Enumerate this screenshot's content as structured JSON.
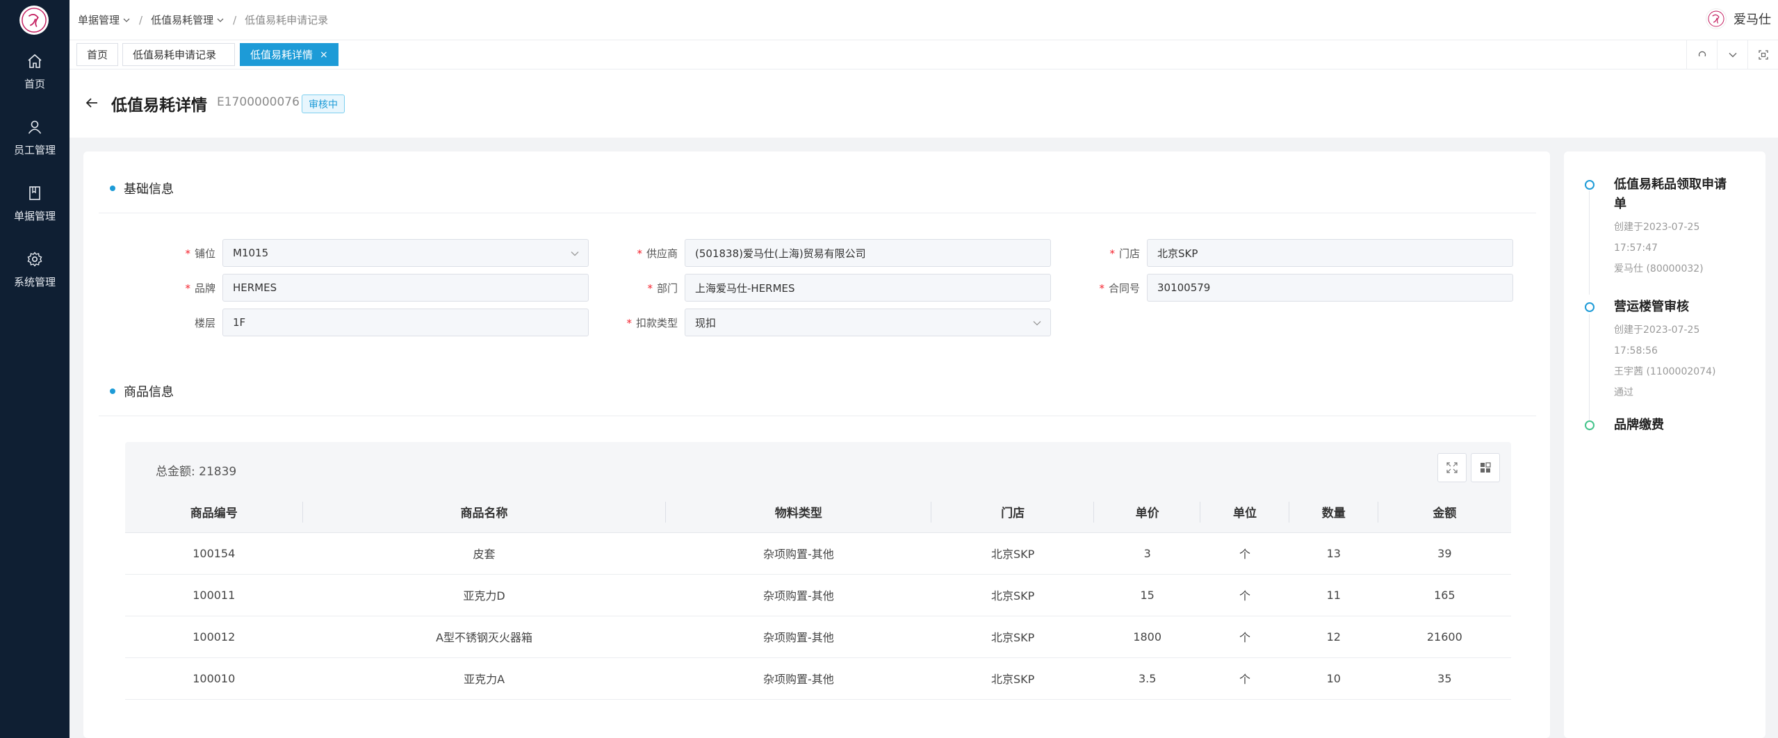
{
  "sidebar": {
    "items": [
      {
        "label": "首页",
        "icon": "home-icon"
      },
      {
        "label": "员工管理",
        "icon": "user-icon"
      },
      {
        "label": "单据管理",
        "icon": "document-icon"
      },
      {
        "label": "系统管理",
        "icon": "gear-icon"
      }
    ]
  },
  "breadcrumb": {
    "items": [
      "单据管理",
      "低值易耗管理",
      "低值易耗申请记录"
    ],
    "separator": "/"
  },
  "user": {
    "name": "爱马仕"
  },
  "tabs": [
    {
      "label": "首页"
    },
    {
      "label": "低值易耗申请记录"
    },
    {
      "label": "低值易耗详情",
      "close": "×"
    }
  ],
  "page": {
    "title": "低值易耗详情",
    "order_no": "E1700000076",
    "status": "审核中"
  },
  "basic_info": {
    "title": "基础信息",
    "fields": [
      {
        "label": "铺位",
        "value": "M1015",
        "required": "*"
      },
      {
        "label": "供应商",
        "value": "(501838)爱马仕(上海)贸易有限公司",
        "required": "*"
      },
      {
        "label": "门店",
        "value": "北京SKP",
        "required": "*"
      },
      {
        "label": "品牌",
        "value": "HERMES",
        "required": "*"
      },
      {
        "label": "部门",
        "value": "上海爱马仕-HERMES",
        "required": "*"
      },
      {
        "label": "合同号",
        "value": "30100579",
        "required": "*"
      },
      {
        "label": "楼层",
        "value": "1F"
      },
      {
        "label": "扣款类型",
        "value": "现扣",
        "required": "*"
      }
    ]
  },
  "goods_info": {
    "title": "商品信息",
    "total_label": "总金额:",
    "total_value": "21839",
    "columns": [
      "商品编号",
      "商品名称",
      "物料类型",
      "门店",
      "单价",
      "单位",
      "数量",
      "金额"
    ],
    "rows": [
      [
        "100154",
        "皮套",
        "杂项购置-其他",
        "北京SKP",
        "3",
        "个",
        "13",
        "39"
      ],
      [
        "100011",
        "亚克力D",
        "杂项购置-其他",
        "北京SKP",
        "15",
        "个",
        "11",
        "165"
      ],
      [
        "100012",
        "A型不锈钢灭火器箱",
        "杂项购置-其他",
        "北京SKP",
        "1800",
        "个",
        "12",
        "21600"
      ],
      [
        "100010",
        "亚克力A",
        "杂项购置-其他",
        "北京SKP",
        "3.5",
        "个",
        "10",
        "35"
      ]
    ]
  },
  "timeline": [
    {
      "title": "低值易耗品领取申请单",
      "meta": [
        "创建于2023-07-25",
        "17:57:47",
        "爱马仕 (80000032)"
      ]
    },
    {
      "title": "营运楼管审核",
      "meta": [
        "创建于2023-07-25",
        "17:58:56",
        "王宇茜 (1100002074)",
        "通过"
      ]
    },
    {
      "title": "品牌缴费",
      "meta": []
    }
  ],
  "colors": {
    "accent": "#1d9bd7",
    "sidebar": "#0f1f33",
    "required": "#f5222d",
    "success": "#44c48b"
  }
}
